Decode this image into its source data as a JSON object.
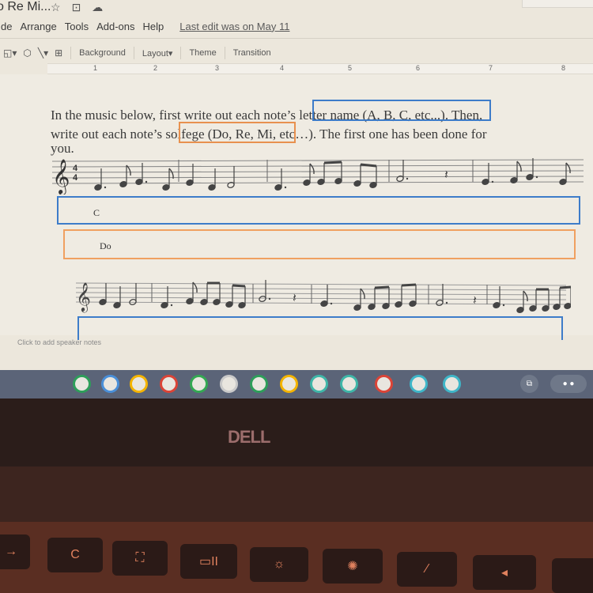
{
  "window": {
    "doc_title": "o Re Mi...",
    "title_icons": [
      "star-icon",
      "move-to-folder-icon",
      "cloud-status-icon"
    ]
  },
  "menu": {
    "items": [
      "de",
      "Arrange",
      "Tools",
      "Add-ons",
      "Help"
    ],
    "last_edit": "Last edit was on May 11"
  },
  "toolbar": {
    "background_label": "Background",
    "layout_label": "Layout",
    "layout_caret": "▾",
    "theme_label": "Theme",
    "transition_label": "Transition"
  },
  "ruler": {
    "marks": [
      "1",
      "2",
      "3",
      "4",
      "5",
      "6",
      "7",
      "8"
    ]
  },
  "slide": {
    "instructions_line1_a": "In the music below, first write out each note’",
    "instructions_line1_b": "s letter name (A, B, C, etc...). Then,",
    "instructions_line2_a": "write out each note’s s",
    "instructions_line2_b": "olfege (Do, Re, Mi, etc…). The first one has been done for",
    "instructions_line3": "you.",
    "staff1": {
      "clef": "𝄞",
      "time_signature": "4/4"
    },
    "letter_answer": "C",
    "solfege_answer": "Do",
    "staff2": {
      "clef": "𝄞"
    }
  },
  "speaker_notes": {
    "placeholder": "Click to add speaker notes"
  },
  "shelf": {
    "apps": [
      {
        "name": "google-sheets-icon",
        "color": "#2e9e5a"
      },
      {
        "name": "google-docs-icon",
        "color": "#4a8fd8"
      },
      {
        "name": "google-slides-icon",
        "color": "#f4b400"
      },
      {
        "name": "chrome-icon",
        "color": "#db4437"
      },
      {
        "name": "google-drive-icon",
        "color": "#34a853"
      },
      {
        "name": "google-calendar-icon",
        "color": "#c9c9c9"
      },
      {
        "name": "google-classroom-icon",
        "color": "#2e9e5a"
      },
      {
        "name": "google-keep-icon",
        "color": "#f4b400"
      },
      {
        "name": "chat-icon",
        "color": "#3fb6a8"
      },
      {
        "name": "app-grid-icon",
        "color": "#3fb6a8"
      },
      {
        "name": "chrome-icon-2",
        "color": "#db4437"
      },
      {
        "name": "camera-icon",
        "color": "#3fb6c8"
      },
      {
        "name": "video-icon",
        "color": "#3fb6c8"
      }
    ],
    "status_icons": [
      "screenshot-icon",
      "settings-icon"
    ]
  },
  "hardware": {
    "brand": "DELL",
    "keys": [
      "→",
      "C",
      "⛶",
      "▭II",
      "☼",
      "✺",
      "⁄",
      "◂"
    ]
  }
}
